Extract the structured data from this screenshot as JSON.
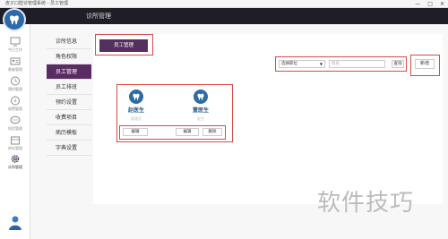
{
  "window": {
    "title": "皮子口腔诊管理系统 - 员工管理",
    "min": "—",
    "max": "□",
    "close": "✕"
  },
  "header": {
    "section_title": "诊所管理"
  },
  "nav": [
    {
      "label": "今日工作",
      "icon": "monitor-icon"
    },
    {
      "label": "患者管理",
      "icon": "id-card-icon"
    },
    {
      "label": "预约管理",
      "icon": "clock-icon"
    },
    {
      "label": "收费管理",
      "icon": "yen-icon"
    },
    {
      "label": "短信管理",
      "icon": "chat-icon"
    },
    {
      "label": "库存管理",
      "icon": "box-icon"
    },
    {
      "label": "诊所管理",
      "icon": "gear-icon",
      "active": true
    }
  ],
  "submenu": [
    {
      "label": "诊所信息"
    },
    {
      "label": "角色权限"
    },
    {
      "label": "员工管理",
      "active": true
    },
    {
      "label": "员工排班"
    },
    {
      "label": "预约设置"
    },
    {
      "label": "收费项目"
    },
    {
      "label": "病历模板"
    },
    {
      "label": "字典设置"
    }
  ],
  "content": {
    "tab_label": "员工管理",
    "filter": {
      "select_value": "选择职位",
      "input_placeholder": "姓名",
      "query_label": "查询"
    },
    "add_label": "新增",
    "staff": [
      {
        "name": "赵医生",
        "role": "管理员"
      },
      {
        "name": "董医生",
        "role": "医生"
      }
    ],
    "actions": {
      "edit1": "编辑",
      "edit2": "编辑",
      "delete": "删除"
    }
  },
  "watermark": "软件技巧",
  "colors": {
    "accent": "#54305f",
    "topbar": "#1e1f26",
    "highlight": "#d84a4a",
    "doctor_blue": "#2e6ba3"
  }
}
